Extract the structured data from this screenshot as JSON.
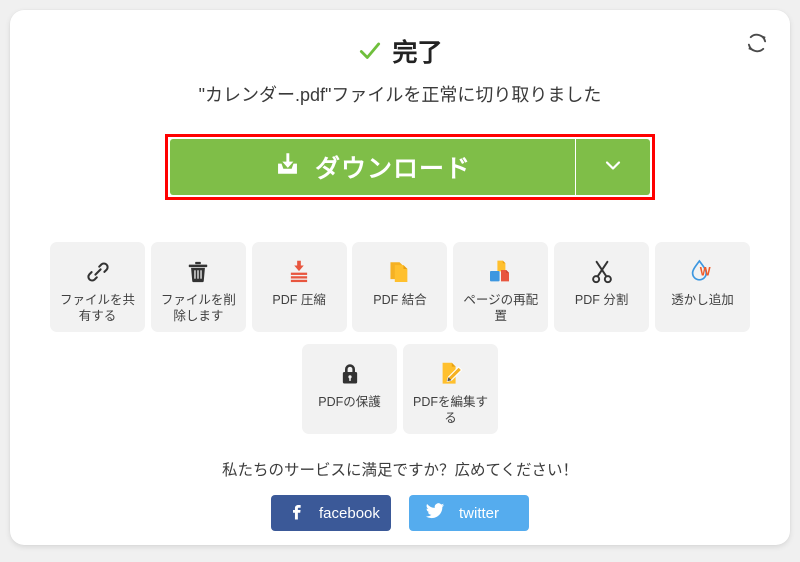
{
  "colors": {
    "green": "#7fbe48",
    "highlight_border": "#ff0000",
    "tile_bg": "#f2f2f2",
    "facebook": "#3b5998",
    "twitter": "#55acee",
    "check": "#6fbf3c"
  },
  "header": {
    "refresh_icon": "refresh-icon"
  },
  "status": {
    "check_icon": "check-icon",
    "title": "完了",
    "subtitle": "\"カレンダー.pdf\"ファイルを正常に切り取りました"
  },
  "download": {
    "icon": "download-icon",
    "label": "ダウンロード",
    "caret_icon": "chevron-down-icon"
  },
  "tools_row_1": [
    {
      "icon": "link-icon",
      "label": "ファイルを共有する"
    },
    {
      "icon": "trash-icon",
      "label": "ファイルを削除します"
    },
    {
      "icon": "compress-icon",
      "label": "PDF 圧縮"
    },
    {
      "icon": "merge-icon",
      "label": "PDF 結合"
    },
    {
      "icon": "organize-icon",
      "label": "ページの再配置"
    },
    {
      "icon": "scissors-icon",
      "label": "PDF 分割"
    },
    {
      "icon": "watermark-icon",
      "label": "透かし追加"
    }
  ],
  "tools_row_2": [
    {
      "icon": "lock-icon",
      "label": "PDFの保護"
    },
    {
      "icon": "edit-icon",
      "label": "PDFを編集する"
    }
  ],
  "share": {
    "prompt": "私たちのサービスに満足ですか？広めてください！",
    "buttons": [
      {
        "icon": "facebook-icon",
        "label": "facebook"
      },
      {
        "icon": "twitter-icon",
        "label": "twitter"
      }
    ]
  }
}
